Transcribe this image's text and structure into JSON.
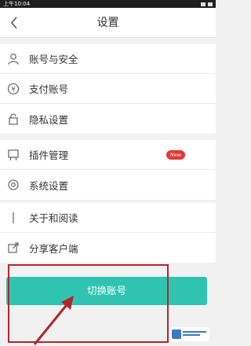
{
  "status_bar": {
    "time": "上午10:04"
  },
  "header": {
    "title": "设置"
  },
  "groups": [
    {
      "items": [
        {
          "label": "账号与安全",
          "icon": "user-icon"
        },
        {
          "label": "支付账号",
          "icon": "yuan-icon"
        },
        {
          "label": "隐私设置",
          "icon": "lock-icon"
        }
      ]
    },
    {
      "items": [
        {
          "label": "插件管理",
          "icon": "plugin-icon",
          "badge": "New"
        },
        {
          "label": "系统设置",
          "icon": "settings-icon"
        }
      ]
    },
    {
      "items": [
        {
          "label": "关于和阅读",
          "icon": "info-icon"
        },
        {
          "label": "分享客户端",
          "icon": "share-icon"
        }
      ]
    }
  ],
  "switch_account": {
    "label": "切换账号"
  },
  "colors": {
    "accent": "#2fc4b2",
    "badge": "#e53935",
    "annotation": "#b3262b"
  }
}
